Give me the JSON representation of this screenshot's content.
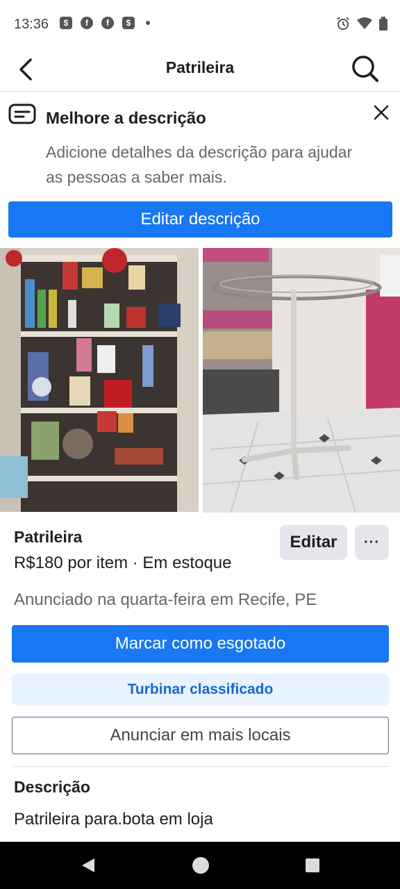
{
  "status_bar": {
    "time": "13:36",
    "notification_icons": [
      "shop-bag-icon",
      "facebook-icon",
      "facebook-icon",
      "shop-bag-icon",
      "dot-icon"
    ],
    "system_icons": [
      "alarm-icon",
      "wifi-icon",
      "battery-icon"
    ]
  },
  "header": {
    "title": "Patrileira",
    "back_icon": "back-arrow-icon",
    "search_icon": "search-icon"
  },
  "suggestion": {
    "icon": "text-bubble-icon",
    "title": "Melhore a descrição",
    "body": "Adicione detalhes da descrição para ajudar as pessoas a saber mais.",
    "button_label": "Editar descrição",
    "close_icon": "close-icon"
  },
  "photos": [
    {
      "name": "photo-shelves"
    },
    {
      "name": "photo-rack"
    }
  ],
  "listing": {
    "title": "Patrileira",
    "price": "R$180 por item · Em estoque",
    "meta": "Anunciado na quarta-feira em Recife, PE",
    "edit_label": "Editar",
    "more_label": "···"
  },
  "actions": {
    "mark_sold": "Marcar como esgotado",
    "boost": "Turbinar classificado",
    "more_places": "Anunciar em mais locais"
  },
  "description": {
    "heading": "Descrição",
    "text": "Patrileira para.bota em loja"
  },
  "colors": {
    "primary": "#1877f2",
    "boost_bg": "#e7f3ff",
    "boost_text": "#1b66c9",
    "secondary_bg": "#e4e6eb"
  }
}
